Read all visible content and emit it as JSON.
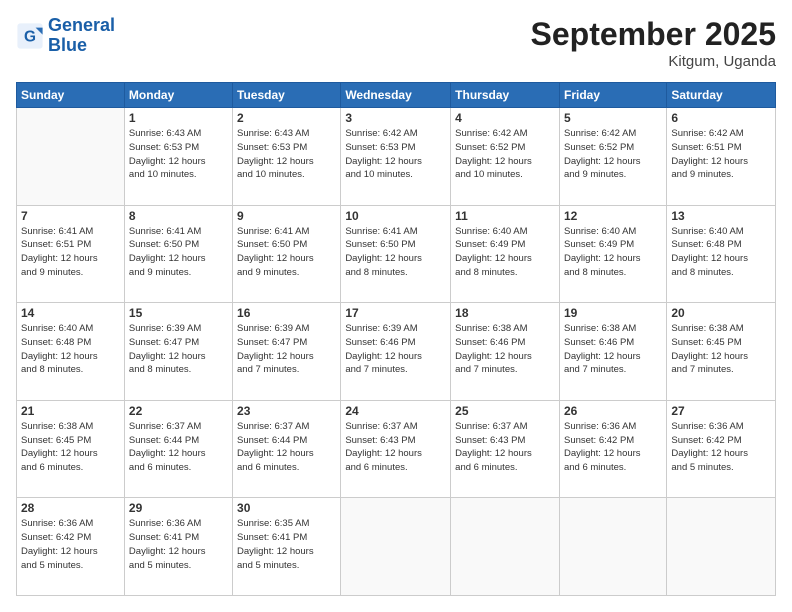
{
  "logo": {
    "line1": "General",
    "line2": "Blue"
  },
  "title": "September 2025",
  "location": "Kitgum, Uganda",
  "days_header": [
    "Sunday",
    "Monday",
    "Tuesday",
    "Wednesday",
    "Thursday",
    "Friday",
    "Saturday"
  ],
  "weeks": [
    [
      {
        "day": "",
        "info": ""
      },
      {
        "day": "1",
        "info": "Sunrise: 6:43 AM\nSunset: 6:53 PM\nDaylight: 12 hours\nand 10 minutes."
      },
      {
        "day": "2",
        "info": "Sunrise: 6:43 AM\nSunset: 6:53 PM\nDaylight: 12 hours\nand 10 minutes."
      },
      {
        "day": "3",
        "info": "Sunrise: 6:42 AM\nSunset: 6:53 PM\nDaylight: 12 hours\nand 10 minutes."
      },
      {
        "day": "4",
        "info": "Sunrise: 6:42 AM\nSunset: 6:52 PM\nDaylight: 12 hours\nand 10 minutes."
      },
      {
        "day": "5",
        "info": "Sunrise: 6:42 AM\nSunset: 6:52 PM\nDaylight: 12 hours\nand 9 minutes."
      },
      {
        "day": "6",
        "info": "Sunrise: 6:42 AM\nSunset: 6:51 PM\nDaylight: 12 hours\nand 9 minutes."
      }
    ],
    [
      {
        "day": "7",
        "info": "Sunrise: 6:41 AM\nSunset: 6:51 PM\nDaylight: 12 hours\nand 9 minutes."
      },
      {
        "day": "8",
        "info": "Sunrise: 6:41 AM\nSunset: 6:50 PM\nDaylight: 12 hours\nand 9 minutes."
      },
      {
        "day": "9",
        "info": "Sunrise: 6:41 AM\nSunset: 6:50 PM\nDaylight: 12 hours\nand 9 minutes."
      },
      {
        "day": "10",
        "info": "Sunrise: 6:41 AM\nSunset: 6:50 PM\nDaylight: 12 hours\nand 8 minutes."
      },
      {
        "day": "11",
        "info": "Sunrise: 6:40 AM\nSunset: 6:49 PM\nDaylight: 12 hours\nand 8 minutes."
      },
      {
        "day": "12",
        "info": "Sunrise: 6:40 AM\nSunset: 6:49 PM\nDaylight: 12 hours\nand 8 minutes."
      },
      {
        "day": "13",
        "info": "Sunrise: 6:40 AM\nSunset: 6:48 PM\nDaylight: 12 hours\nand 8 minutes."
      }
    ],
    [
      {
        "day": "14",
        "info": "Sunrise: 6:40 AM\nSunset: 6:48 PM\nDaylight: 12 hours\nand 8 minutes."
      },
      {
        "day": "15",
        "info": "Sunrise: 6:39 AM\nSunset: 6:47 PM\nDaylight: 12 hours\nand 8 minutes."
      },
      {
        "day": "16",
        "info": "Sunrise: 6:39 AM\nSunset: 6:47 PM\nDaylight: 12 hours\nand 7 minutes."
      },
      {
        "day": "17",
        "info": "Sunrise: 6:39 AM\nSunset: 6:46 PM\nDaylight: 12 hours\nand 7 minutes."
      },
      {
        "day": "18",
        "info": "Sunrise: 6:38 AM\nSunset: 6:46 PM\nDaylight: 12 hours\nand 7 minutes."
      },
      {
        "day": "19",
        "info": "Sunrise: 6:38 AM\nSunset: 6:46 PM\nDaylight: 12 hours\nand 7 minutes."
      },
      {
        "day": "20",
        "info": "Sunrise: 6:38 AM\nSunset: 6:45 PM\nDaylight: 12 hours\nand 7 minutes."
      }
    ],
    [
      {
        "day": "21",
        "info": "Sunrise: 6:38 AM\nSunset: 6:45 PM\nDaylight: 12 hours\nand 6 minutes."
      },
      {
        "day": "22",
        "info": "Sunrise: 6:37 AM\nSunset: 6:44 PM\nDaylight: 12 hours\nand 6 minutes."
      },
      {
        "day": "23",
        "info": "Sunrise: 6:37 AM\nSunset: 6:44 PM\nDaylight: 12 hours\nand 6 minutes."
      },
      {
        "day": "24",
        "info": "Sunrise: 6:37 AM\nSunset: 6:43 PM\nDaylight: 12 hours\nand 6 minutes."
      },
      {
        "day": "25",
        "info": "Sunrise: 6:37 AM\nSunset: 6:43 PM\nDaylight: 12 hours\nand 6 minutes."
      },
      {
        "day": "26",
        "info": "Sunrise: 6:36 AM\nSunset: 6:42 PM\nDaylight: 12 hours\nand 6 minutes."
      },
      {
        "day": "27",
        "info": "Sunrise: 6:36 AM\nSunset: 6:42 PM\nDaylight: 12 hours\nand 5 minutes."
      }
    ],
    [
      {
        "day": "28",
        "info": "Sunrise: 6:36 AM\nSunset: 6:42 PM\nDaylight: 12 hours\nand 5 minutes."
      },
      {
        "day": "29",
        "info": "Sunrise: 6:36 AM\nSunset: 6:41 PM\nDaylight: 12 hours\nand 5 minutes."
      },
      {
        "day": "30",
        "info": "Sunrise: 6:35 AM\nSunset: 6:41 PM\nDaylight: 12 hours\nand 5 minutes."
      },
      {
        "day": "",
        "info": ""
      },
      {
        "day": "",
        "info": ""
      },
      {
        "day": "",
        "info": ""
      },
      {
        "day": "",
        "info": ""
      }
    ]
  ]
}
